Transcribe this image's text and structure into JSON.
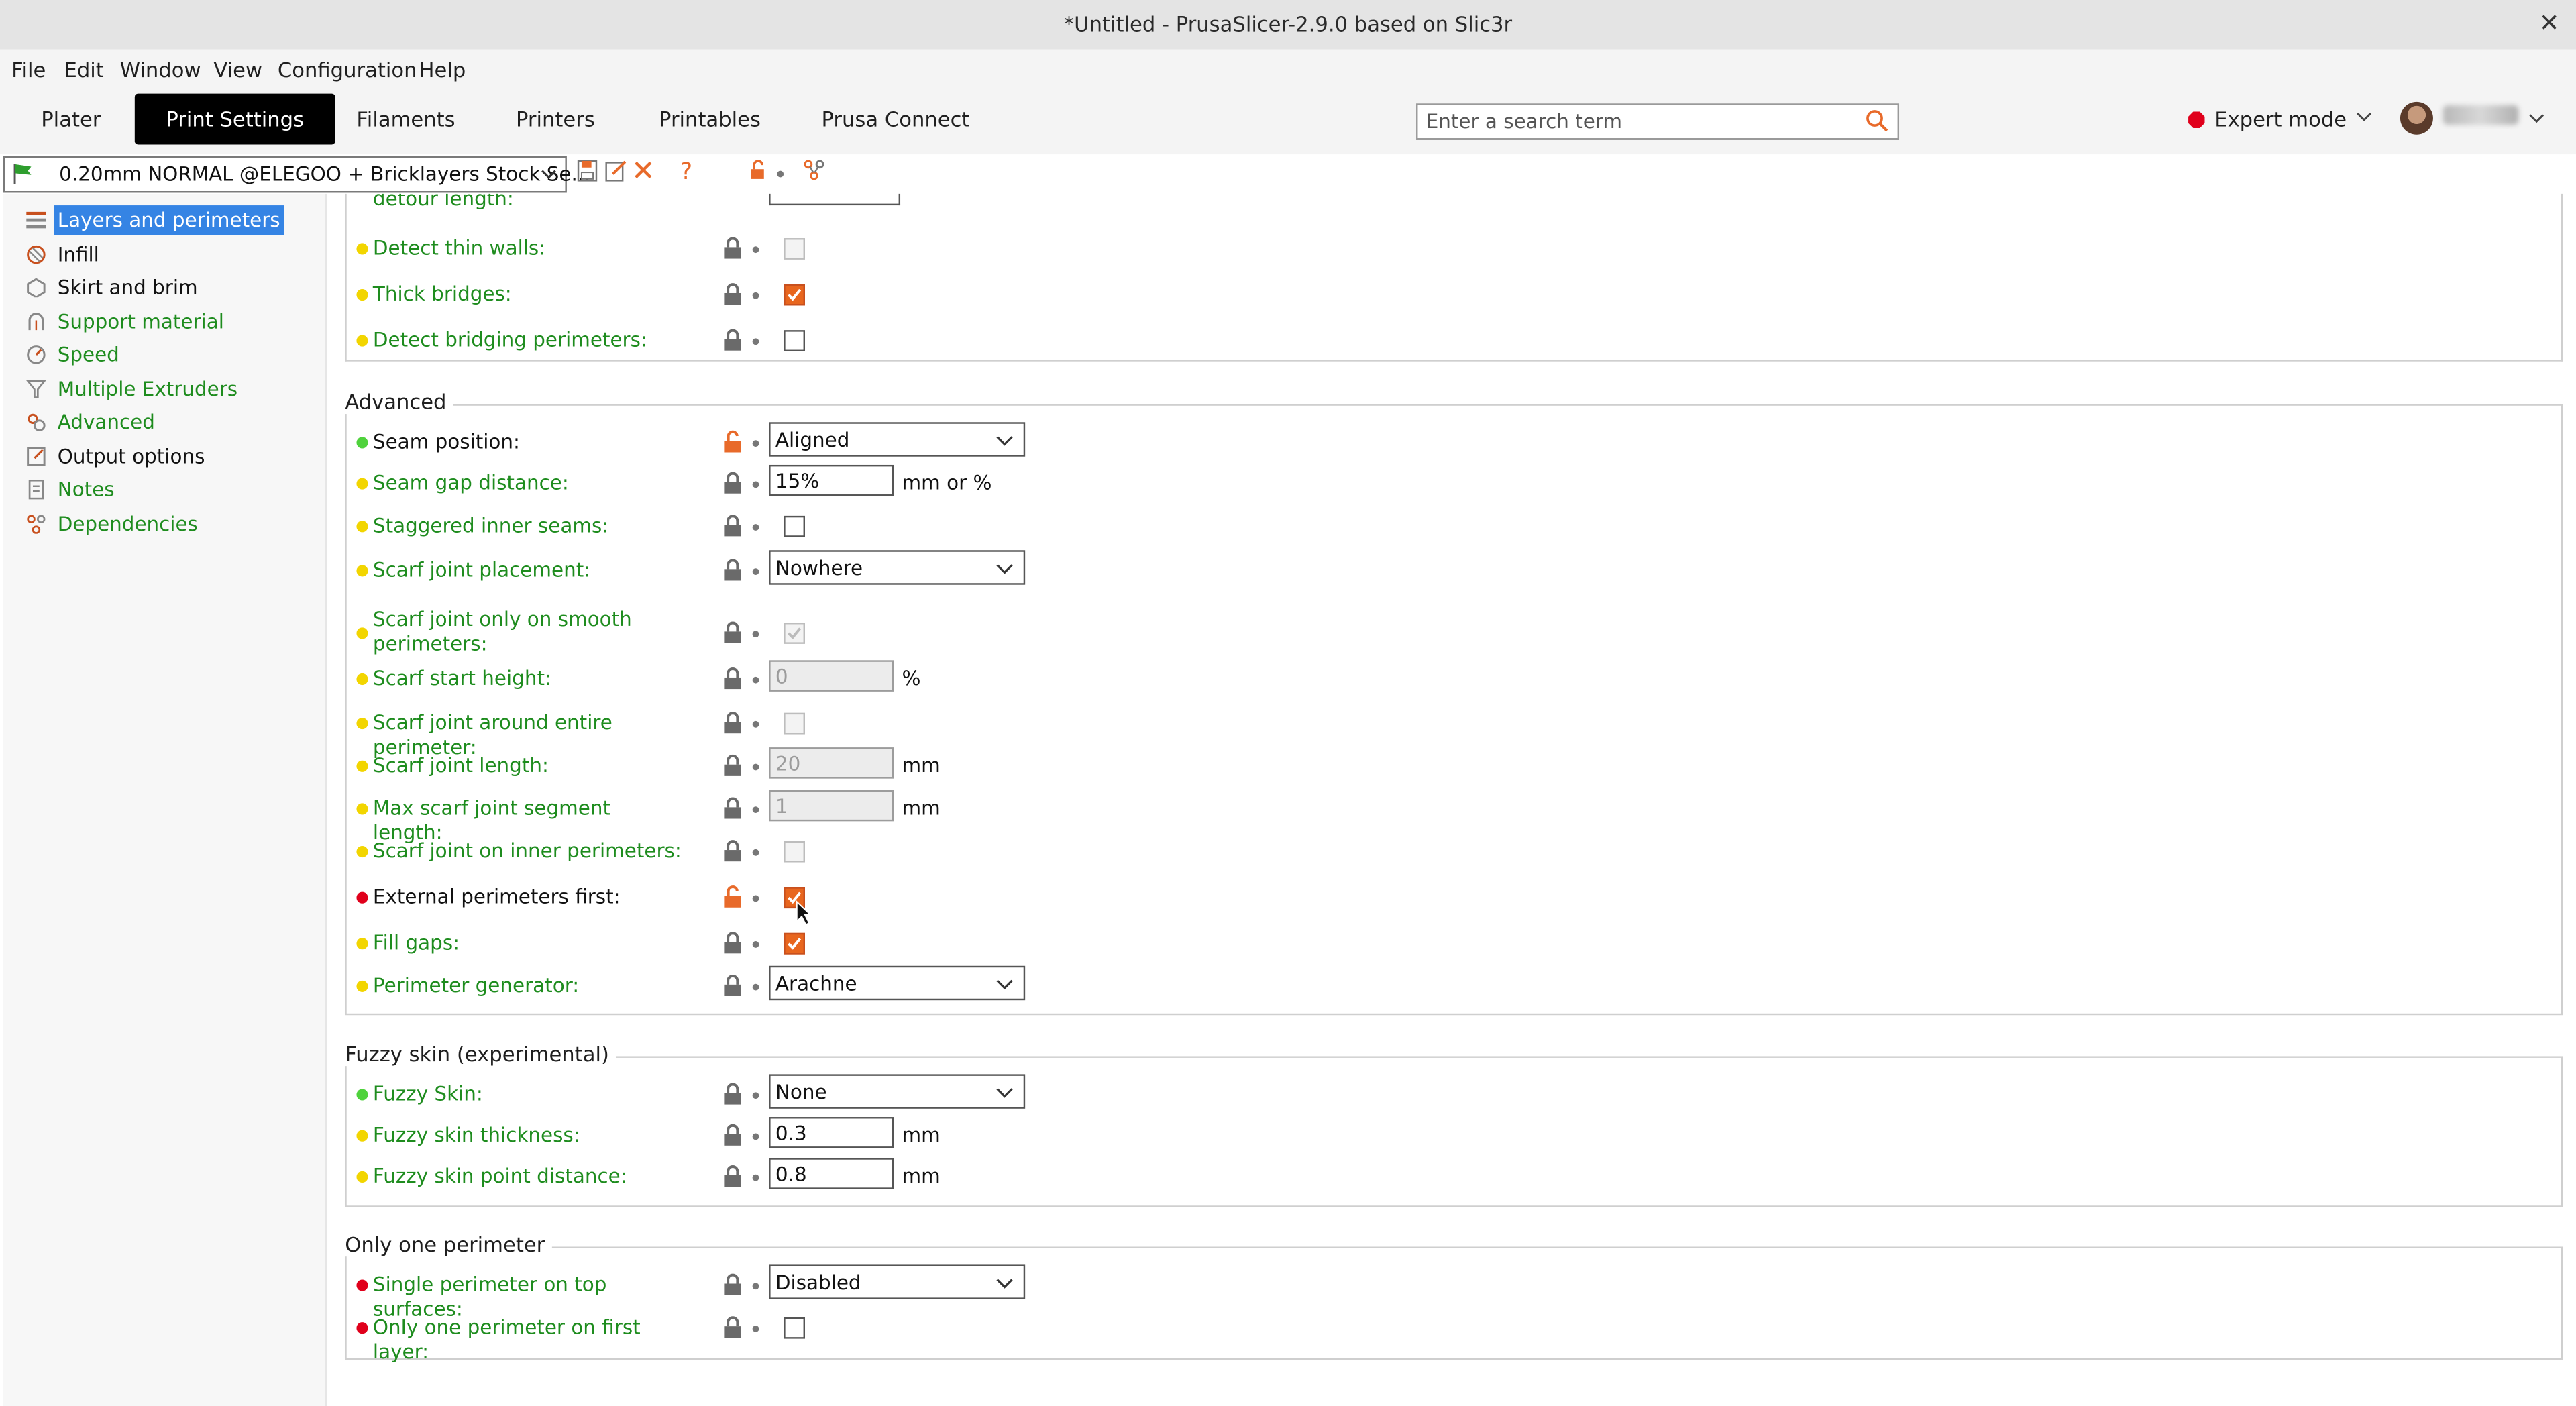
{
  "window": {
    "title": "*Untitled - PrusaSlicer-2.9.0 based on Slic3r",
    "close_glyph": "✕"
  },
  "menu": [
    "File",
    "Edit",
    "Window",
    "View",
    "Configuration",
    "Help"
  ],
  "tabs": [
    "Plater",
    "Print Settings",
    "Filaments",
    "Printers",
    "Printables",
    "Prusa Connect"
  ],
  "active_tab": "Print Settings",
  "search": {
    "placeholder": "Enter a search term",
    "value": ""
  },
  "mode": {
    "label": "Expert mode",
    "color": "#e0001b"
  },
  "preset": {
    "name": "0.20mm NORMAL @ELEGOO + Bricklayers Stock Se...",
    "flag_color": "#2e9e2e"
  },
  "sidebar": [
    {
      "label": "Layers and perimeters",
      "icon": "layers-icon",
      "color": "black",
      "selected": true
    },
    {
      "label": "Infill",
      "icon": "infill-icon",
      "color": "black"
    },
    {
      "label": "Skirt and brim",
      "icon": "skirt-icon",
      "color": "black"
    },
    {
      "label": "Support material",
      "icon": "support-icon",
      "color": "green"
    },
    {
      "label": "Speed",
      "icon": "speed-icon",
      "color": "green"
    },
    {
      "label": "Multiple Extruders",
      "icon": "funnel-icon",
      "color": "green"
    },
    {
      "label": "Advanced",
      "icon": "advanced-icon",
      "color": "green"
    },
    {
      "label": "Output options",
      "icon": "output-icon",
      "color": "black"
    },
    {
      "label": "Notes",
      "icon": "notes-icon",
      "color": "green"
    },
    {
      "label": "Dependencies",
      "icon": "dependencies-icon",
      "color": "green"
    }
  ],
  "top_rows": {
    "partial_label": "detour length:",
    "rows": [
      {
        "label": "Detect thin walls:",
        "type": "checkbox",
        "checked": false,
        "disabled": true,
        "status": "yellow"
      },
      {
        "label": "Thick bridges:",
        "type": "checkbox",
        "checked": true,
        "status": "yellow"
      },
      {
        "label": "Detect bridging perimeters:",
        "type": "checkbox",
        "checked": false,
        "status": "yellow"
      }
    ]
  },
  "groups": {
    "advanced": {
      "title": "Advanced",
      "rows": [
        {
          "label": "Seam position:",
          "type": "combo",
          "value": "Aligned",
          "status": "green",
          "lock": "unlocked",
          "label_color": "black"
        },
        {
          "label": "Seam gap distance:",
          "type": "field",
          "value": "15%",
          "unit": "mm or %",
          "status": "yellow"
        },
        {
          "label": "Staggered inner seams:",
          "type": "checkbox",
          "checked": false,
          "status": "yellow"
        },
        {
          "label": "Scarf joint placement:",
          "type": "combo",
          "value": "Nowhere",
          "status": "yellow"
        },
        {
          "label": "Scarf joint only on smooth perimeters:",
          "type": "checkbox",
          "checked": true,
          "disabled": true,
          "status": "yellow",
          "two_line": true
        },
        {
          "label": "Scarf start height:",
          "type": "field",
          "value": "0",
          "unit": "%",
          "disabled": true,
          "status": "yellow"
        },
        {
          "label": "Scarf joint around entire perimeter:",
          "type": "checkbox",
          "checked": false,
          "disabled": true,
          "status": "yellow"
        },
        {
          "label": "Scarf joint length:",
          "type": "field",
          "value": "20",
          "unit": "mm",
          "disabled": true,
          "status": "yellow"
        },
        {
          "label": "Max scarf joint segment length:",
          "type": "field",
          "value": "1",
          "unit": "mm",
          "disabled": true,
          "status": "yellow"
        },
        {
          "label": "Scarf joint on inner perimeters:",
          "type": "checkbox",
          "checked": false,
          "disabled": true,
          "status": "yellow"
        },
        {
          "label": "External perimeters first:",
          "type": "checkbox",
          "checked": true,
          "status": "red",
          "lock": "unlocked",
          "label_color": "black"
        },
        {
          "label": "Fill gaps:",
          "type": "checkbox",
          "checked": true,
          "status": "yellow"
        },
        {
          "label": "Perimeter generator:",
          "type": "combo",
          "value": "Arachne",
          "status": "yellow"
        }
      ]
    },
    "fuzzy": {
      "title": "Fuzzy skin (experimental)",
      "rows": [
        {
          "label": "Fuzzy Skin:",
          "type": "combo",
          "value": "None",
          "status": "green"
        },
        {
          "label": "Fuzzy skin thickness:",
          "type": "field",
          "value": "0.3",
          "unit": "mm",
          "status": "yellow"
        },
        {
          "label": "Fuzzy skin point distance:",
          "type": "field",
          "value": "0.8",
          "unit": "mm",
          "status": "yellow"
        }
      ]
    },
    "one_perimeter": {
      "title": "Only one perimeter",
      "rows": [
        {
          "label": "Single perimeter on top surfaces:",
          "type": "combo",
          "value": "Disabled",
          "status": "red"
        },
        {
          "label": "Only one perimeter on first layer:",
          "type": "checkbox",
          "checked": false,
          "status": "red"
        }
      ]
    }
  },
  "colors": {
    "status_green": "#4fd23c",
    "status_yellow": "#f2d500",
    "status_red": "#e0001b",
    "label_green": "#1e8c1e",
    "accent_orange": "#e86a2a",
    "selection_blue": "#3584e4"
  }
}
